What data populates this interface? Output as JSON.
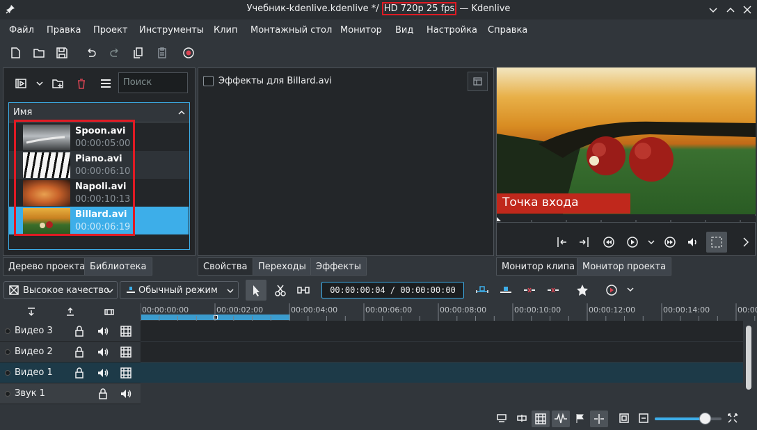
{
  "window": {
    "title_prefix": "Учебник-kdenlive.kdenlive */ ",
    "title_profile": "HD 720p 25 fps",
    "title_suffix": " — Kdenlive"
  },
  "menu": [
    "Файл",
    "Правка",
    "Проект",
    "Инструменты",
    "Клип",
    "Монтажный стол",
    "Монитор",
    "Вид",
    "Настройка",
    "Справка"
  ],
  "bin": {
    "search_placeholder": "Поиск",
    "column_header": "Имя",
    "clips": [
      {
        "name": "Spoon.avi",
        "duration": "00:00:05:00"
      },
      {
        "name": "Piano.avi",
        "duration": "00:00:06:10"
      },
      {
        "name": "Napoli.avi",
        "duration": "00:00:10:13"
      },
      {
        "name": "Billard.avi",
        "duration": "00:00:06:19"
      }
    ],
    "tabs": [
      "Дерево проекта",
      "Библиотека"
    ]
  },
  "effects": {
    "checkbox_label": "Эффекты для Billard.avi",
    "tabs": [
      "Свойства",
      "Переходы",
      "Эффекты"
    ]
  },
  "monitor": {
    "overlay_label": "Точка входа",
    "tabs": [
      "Монитор клипа",
      "Монитор проекта"
    ]
  },
  "timeline_toolbar": {
    "quality": "Высокое качество",
    "mode": "Обычный режим",
    "timecode": "00:00:00:04 / 00:00:00:00"
  },
  "ruler": [
    "00:00:00:00",
    "00:00:02:00",
    "00:00:04:00",
    "00:00:06:00",
    "00:00:08:00",
    "00:00:10:00",
    "00:00:12:00",
    "00:00:14:00",
    "00:00:1"
  ],
  "tracks": [
    {
      "name": "Видео 3",
      "selected": false
    },
    {
      "name": "Видео 2",
      "selected": false
    },
    {
      "name": "Видео 1",
      "selected": true
    },
    {
      "name": "Звук 1",
      "selected": false
    }
  ],
  "colors": {
    "accent": "#3daee9",
    "highlight_box": "#e01b24",
    "selection": "#3daee9",
    "overlay_bg": "#c0281c"
  },
  "zoom_level": 0.75
}
